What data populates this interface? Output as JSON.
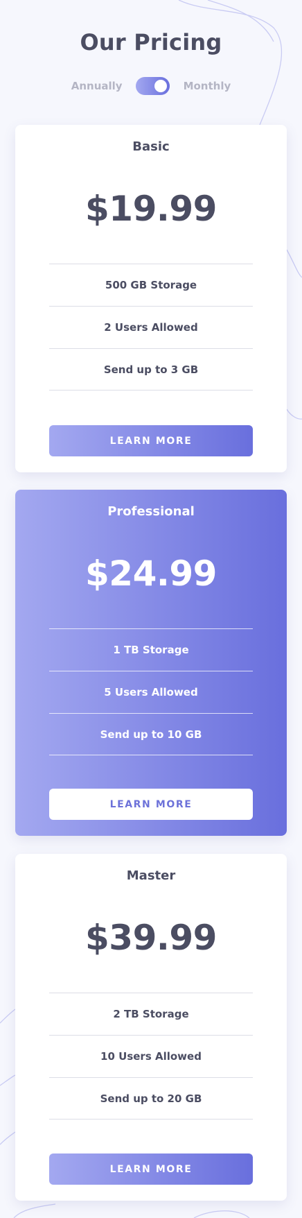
{
  "header": {
    "title": "Our Pricing"
  },
  "billing_toggle": {
    "left_label": "Annually",
    "right_label": "Monthly",
    "state": "monthly"
  },
  "colors": {
    "gradient_start": "#a3a8f0",
    "gradient_end": "#696fdd",
    "text_dark": "#4b4d62",
    "text_muted": "#b4b5c4",
    "background": "#f6f7fd"
  },
  "plans": [
    {
      "name": "Basic",
      "price": "$19.99",
      "features": [
        "500 GB Storage",
        "2 Users Allowed",
        "Send up to 3 GB"
      ],
      "cta": "LEARN MORE"
    },
    {
      "name": "Professional",
      "price": "$24.99",
      "features": [
        "1 TB Storage",
        "5 Users Allowed",
        "Send up to 10 GB"
      ],
      "cta": "LEARN MORE",
      "highlighted": true
    },
    {
      "name": "Master",
      "price": "$39.99",
      "features": [
        "2 TB Storage",
        "10 Users Allowed",
        "Send up to 20 GB"
      ],
      "cta": "LEARN MORE"
    }
  ]
}
